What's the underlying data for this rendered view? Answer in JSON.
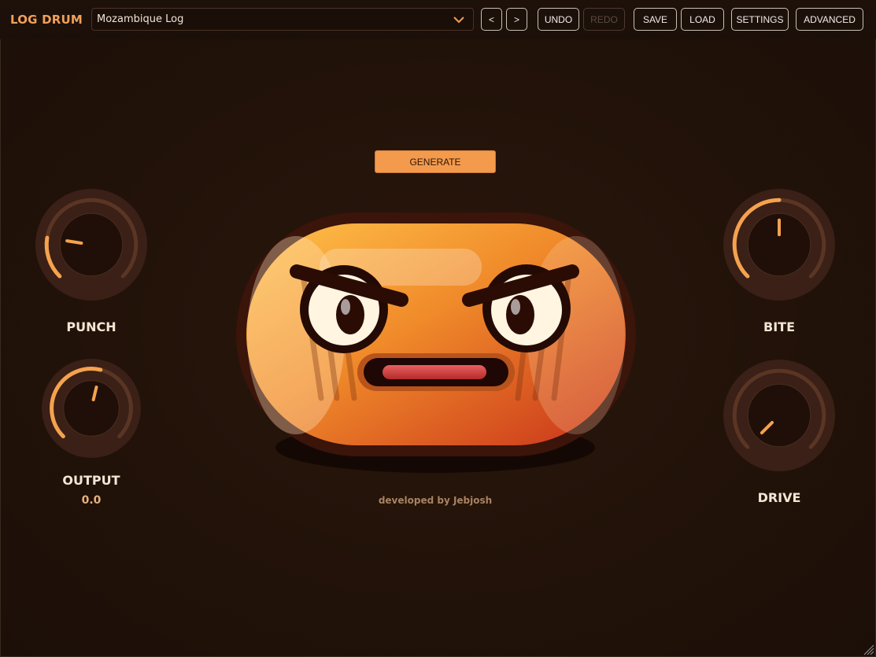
{
  "header": {
    "app_title": "LOG DRUM",
    "preset": "Mozambique Log",
    "prev_label": "<",
    "next_label": ">",
    "undo_label": "UNDO",
    "redo_label": "REDO",
    "save_label": "SAVE",
    "load_label": "LOAD",
    "settings_label": "SETTINGS",
    "advanced_label": "ADVANCED"
  },
  "main": {
    "generate_label": "GENERATE",
    "credit": "developed by Jebjosh"
  },
  "knobs": {
    "punch": {
      "label": "PUNCH",
      "value_fraction": 0.2
    },
    "output": {
      "label": "OUTPUT",
      "value": "0.0",
      "value_fraction": 0.55
    },
    "bite": {
      "label": "BITE",
      "value_fraction": 0.5
    },
    "drive": {
      "label": "DRIVE",
      "value_fraction": 0.0
    }
  },
  "colors": {
    "accent": "#f0a15a",
    "background": "#231309",
    "knob_arc": "#f5a24e"
  }
}
